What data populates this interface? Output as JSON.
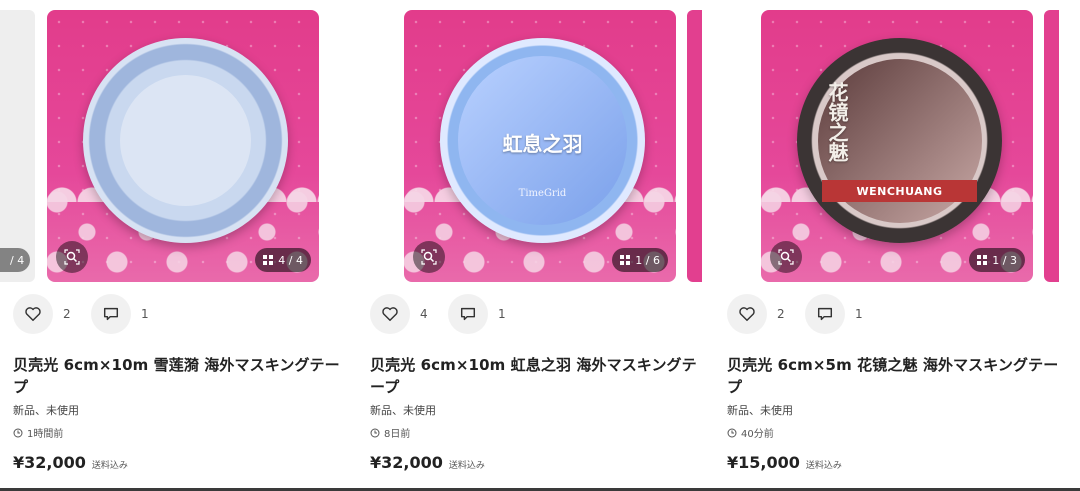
{
  "listings": [
    {
      "photo_label": "",
      "tape_brand": "",
      "counter": "4 / 4",
      "prev_counter": "/ 4",
      "likes": "2",
      "comments": "1",
      "title": "贝壳光 6cm×10m 雪莲漪 海外マスキングテープ",
      "condition": "新品、未使用",
      "time": "1時間前",
      "price": "¥32,000",
      "shipping": "送料込み"
    },
    {
      "photo_label": "虹息之羽",
      "tape_brand": "TimeGrid",
      "counter": "1 / 6",
      "likes": "4",
      "comments": "1",
      "title": "贝壳光 6cm×10m 虹息之羽 海外マスキングテープ",
      "condition": "新品、未使用",
      "time": "8日前",
      "price": "¥32,000",
      "shipping": "送料込み"
    },
    {
      "photo_label": "花镜之魅",
      "tape_brand": "WENCHUANG",
      "counter": "1 / 3",
      "likes": "2",
      "comments": "1",
      "title": "贝壳光 6cm×5m 花镜之魅 海外マスキングテープ",
      "condition": "新品、未使用",
      "time": "40分前",
      "price": "¥15,000",
      "shipping": "送料込み"
    }
  ],
  "icons": {
    "like": "heart-icon",
    "comment": "comment-icon",
    "zoom": "image-search-icon",
    "gallery": "grid-icon",
    "time": "clock-icon"
  },
  "colors": {
    "photo_bg": "#e23c8b",
    "text": "#222222"
  }
}
